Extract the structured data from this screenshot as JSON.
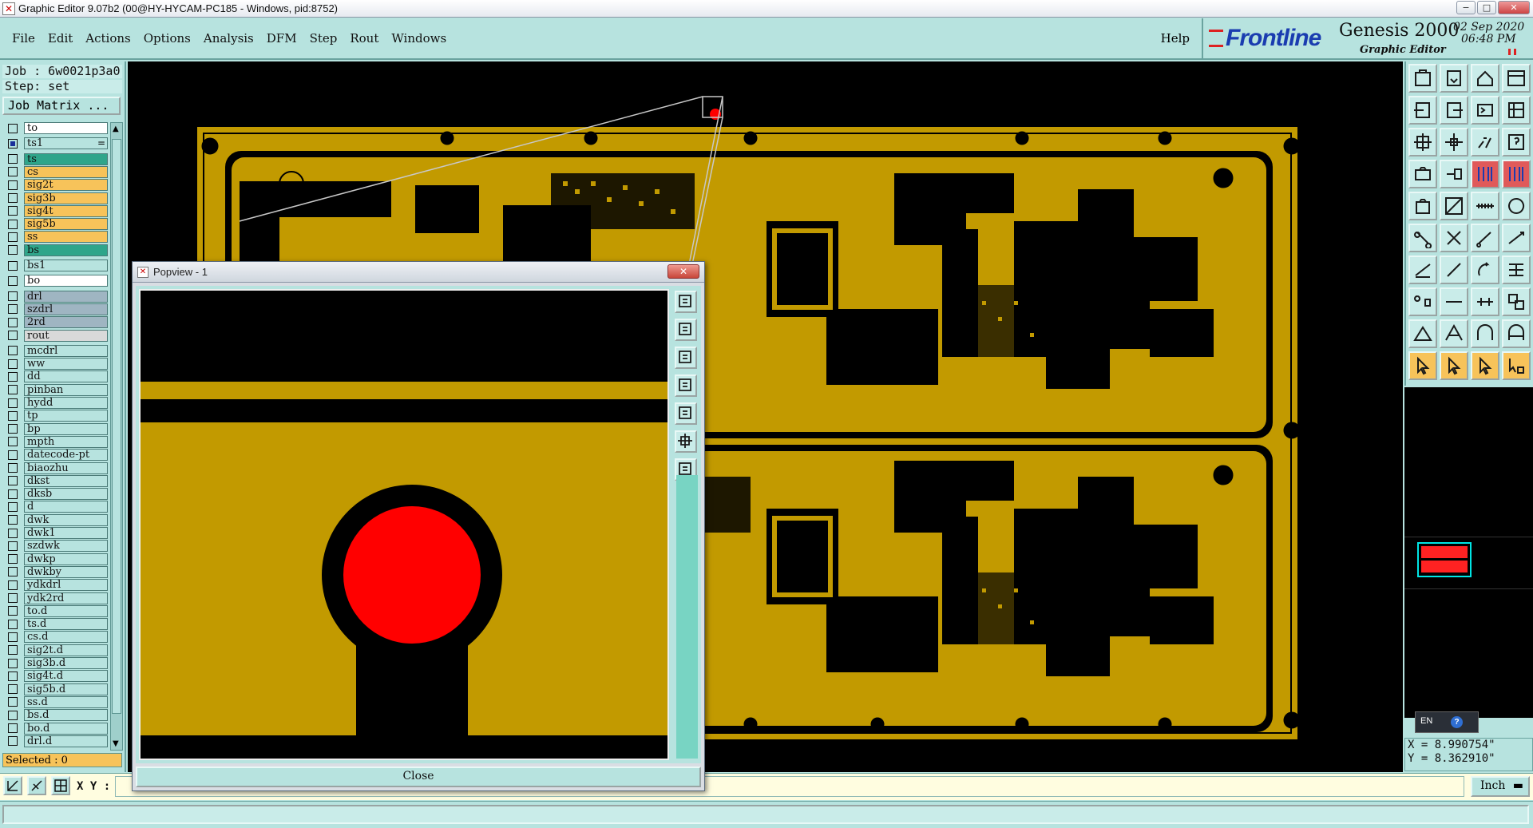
{
  "window": {
    "title": "Graphic Editor 9.07b2 (00@HY-HYCAM-PC185 - Windows, pid:8752)",
    "controls": [
      "−",
      "□",
      "✕"
    ]
  },
  "menu": {
    "items": [
      "File",
      "Edit",
      "Actions",
      "Options",
      "Analysis",
      "DFM",
      "Step",
      "Rout",
      "Windows"
    ],
    "help": "Help"
  },
  "brand": {
    "logo": "Frontline",
    "product": "Genesis 2000",
    "subtitle": "Graphic Editor",
    "date": "02 Sep 2020",
    "time": "06:48 PM"
  },
  "job": {
    "job_line": "Job : 6w0021p3a0",
    "step_line": "Step: set",
    "job_matrix": "Job Matrix ..."
  },
  "layers": [
    {
      "name": "to",
      "color": "#ffffff",
      "checked": false
    },
    {
      "name": "ts1",
      "color": "#b7e3df",
      "checked": true,
      "marker": "="
    },
    {
      "name": "ts",
      "color": "#2fa58a",
      "checked": false
    },
    {
      "name": "cs",
      "color": "#f7c35a",
      "checked": false
    },
    {
      "name": "sig2t",
      "color": "#f7c35a",
      "checked": false
    },
    {
      "name": "sig3b",
      "color": "#f7c35a",
      "checked": false
    },
    {
      "name": "sig4t",
      "color": "#f7c35a",
      "checked": false
    },
    {
      "name": "sig5b",
      "color": "#f7c35a",
      "checked": false
    },
    {
      "name": "ss",
      "color": "#f7c35a",
      "checked": false
    },
    {
      "name": "bs",
      "color": "#2fa58a",
      "checked": false
    },
    {
      "name": "bs1",
      "color": "#b7e3df",
      "checked": false
    },
    {
      "name": "bo",
      "color": "#ffffff",
      "checked": false
    },
    {
      "name": "drl",
      "color": "#9fb5c2",
      "checked": false
    },
    {
      "name": "szdrl",
      "color": "#9fb5c2",
      "checked": false
    },
    {
      "name": "2rd",
      "color": "#9fb5c2",
      "checked": false
    },
    {
      "name": "rout",
      "color": "#d9d9d9",
      "checked": false
    },
    {
      "name": "mcdrl",
      "color": "#b7e3df",
      "checked": false
    },
    {
      "name": "ww",
      "color": "#b7e3df",
      "checked": false
    },
    {
      "name": "dd",
      "color": "#b7e3df",
      "checked": false
    },
    {
      "name": "pinban",
      "color": "#b7e3df",
      "checked": false
    },
    {
      "name": "hydd",
      "color": "#b7e3df",
      "checked": false
    },
    {
      "name": "tp",
      "color": "#b7e3df",
      "checked": false
    },
    {
      "name": "bp",
      "color": "#b7e3df",
      "checked": false
    },
    {
      "name": "mpth",
      "color": "#b7e3df",
      "checked": false
    },
    {
      "name": "datecode-pt",
      "color": "#b7e3df",
      "checked": false
    },
    {
      "name": "biaozhu",
      "color": "#b7e3df",
      "checked": false
    },
    {
      "name": "dkst",
      "color": "#b7e3df",
      "checked": false
    },
    {
      "name": "dksb",
      "color": "#b7e3df",
      "checked": false
    },
    {
      "name": "d",
      "color": "#b7e3df",
      "checked": false
    },
    {
      "name": "dwk",
      "color": "#b7e3df",
      "checked": false
    },
    {
      "name": "dwk1",
      "color": "#b7e3df",
      "checked": false
    },
    {
      "name": "szdwk",
      "color": "#b7e3df",
      "checked": false
    },
    {
      "name": "dwkp",
      "color": "#b7e3df",
      "checked": false
    },
    {
      "name": "dwkby",
      "color": "#b7e3df",
      "checked": false
    },
    {
      "name": "ydkdrl",
      "color": "#b7e3df",
      "checked": false
    },
    {
      "name": "ydk2rd",
      "color": "#b7e3df",
      "checked": false
    },
    {
      "name": "to.d",
      "color": "#b7e3df",
      "checked": false
    },
    {
      "name": "ts.d",
      "color": "#b7e3df",
      "checked": false
    },
    {
      "name": "cs.d",
      "color": "#b7e3df",
      "checked": false
    },
    {
      "name": "sig2t.d",
      "color": "#b7e3df",
      "checked": false
    },
    {
      "name": "sig3b.d",
      "color": "#b7e3df",
      "checked": false
    },
    {
      "name": "sig4t.d",
      "color": "#b7e3df",
      "checked": false
    },
    {
      "name": "sig5b.d",
      "color": "#b7e3df",
      "checked": false
    },
    {
      "name": "ss.d",
      "color": "#b7e3df",
      "checked": false
    },
    {
      "name": "bs.d",
      "color": "#b7e3df",
      "checked": false
    },
    {
      "name": "bo.d",
      "color": "#b7e3df",
      "checked": false
    },
    {
      "name": "drl.d",
      "color": "#b7e3df",
      "checked": false
    }
  ],
  "status": {
    "selected": "Selected : 0",
    "xy_label": "X Y :",
    "xy_value": "",
    "units": "Inch",
    "x_coord": "X = 8.990754\"",
    "y_coord": "Y = 8.362910\""
  },
  "ime": {
    "lang": "EN",
    "help": "?"
  },
  "popview": {
    "title": "Popview - 1",
    "close_label": "Close",
    "title_close": "✕"
  },
  "colors": {
    "copper": "#c29a00",
    "highlight": "#ff0000",
    "panel": "#b7e3df",
    "accent_border": "#6aa39f",
    "selected_bg": "#f7c35a"
  }
}
